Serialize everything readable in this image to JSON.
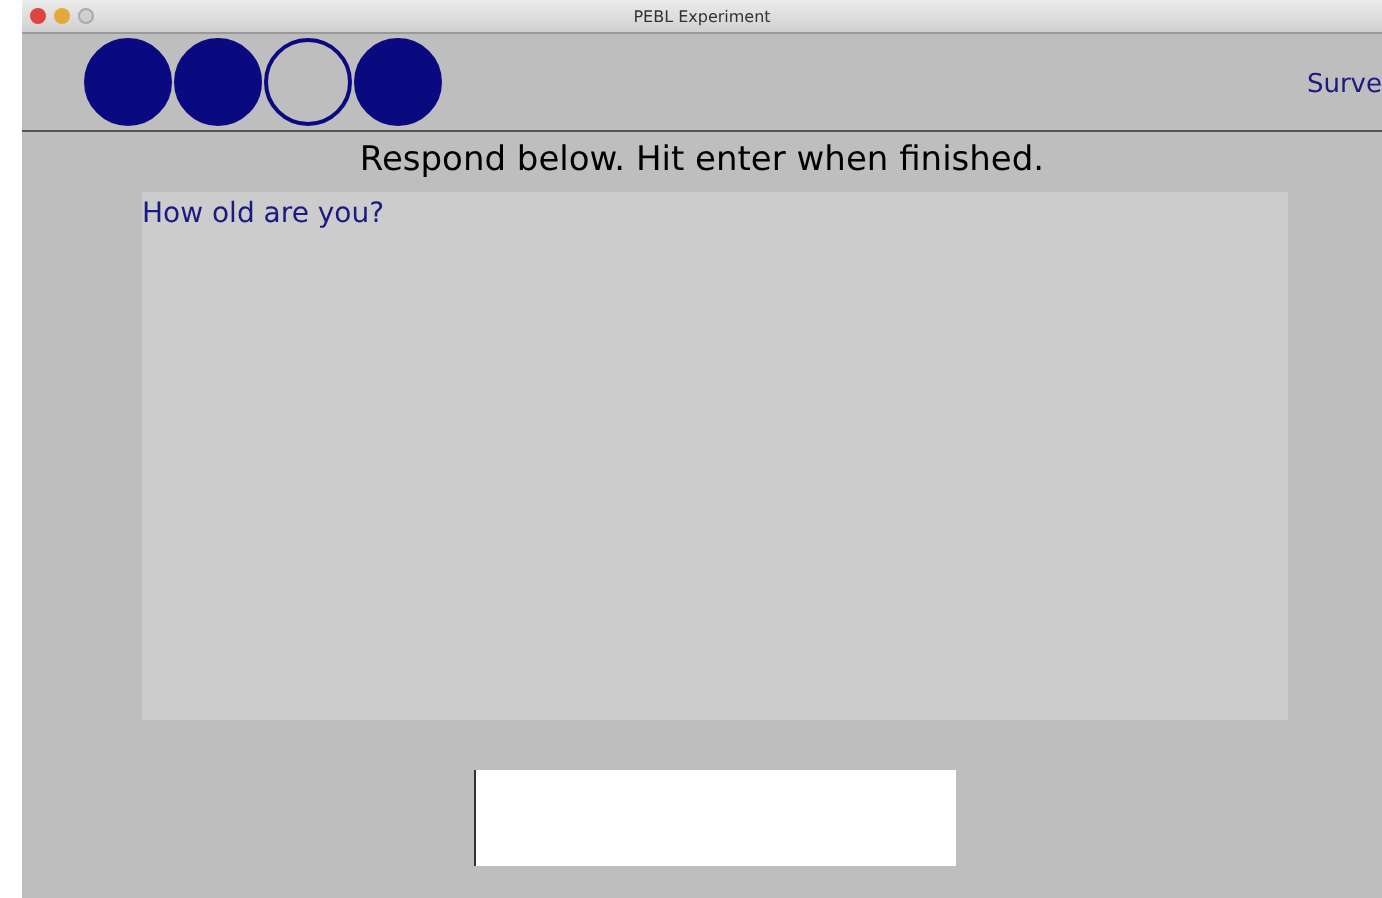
{
  "window": {
    "title": "PEBL Experiment"
  },
  "progress": [
    {
      "filled": true
    },
    {
      "filled": true
    },
    {
      "filled": false
    },
    {
      "filled": true
    }
  ],
  "header_label": "Surve",
  "instruction": "Respond below. Hit enter when finished.",
  "question": "How old are you?"
}
